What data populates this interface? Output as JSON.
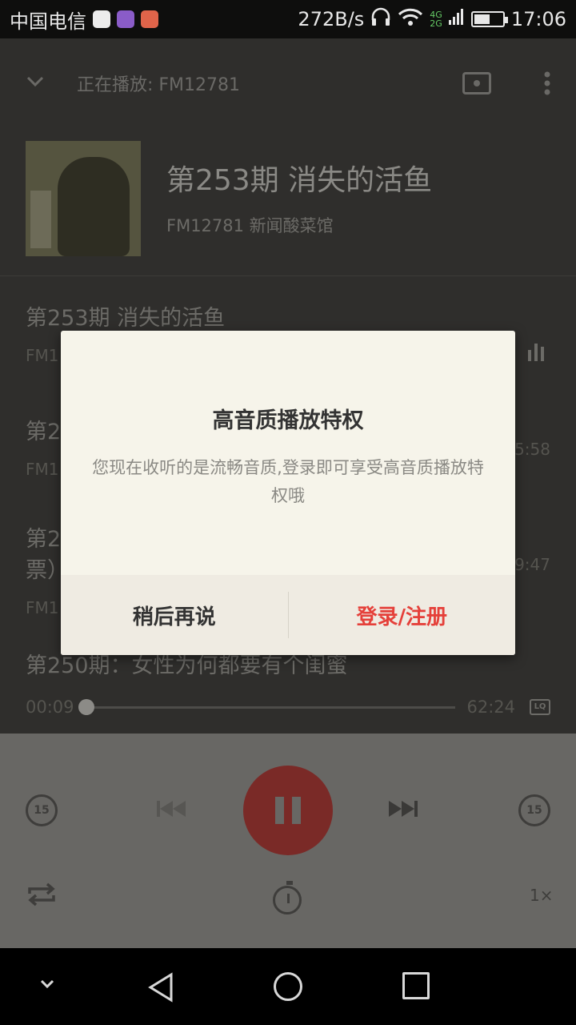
{
  "status_bar": {
    "carrier": "中国电信",
    "net_speed": "272B/s",
    "net_4g": "4G",
    "net_2g": "2G",
    "time": "17:06",
    "battery_level": 0.55
  },
  "header": {
    "now_playing_label": "正在播放: FM12781"
  },
  "now_playing": {
    "title": "第253期 消失的活鱼",
    "subtitle": "FM12781 新闻酸菜馆"
  },
  "episodes": [
    {
      "title": "第253期 消失的活鱼",
      "sub": "FM1",
      "duration": ""
    },
    {
      "title": "第2",
      "sub": "FM1",
      "duration": "5:58"
    },
    {
      "title": "第2",
      "title2": "票）",
      "sub": "FM1",
      "duration": "9:47"
    },
    {
      "title": "第250期：女性为何都要有个闺蜜",
      "sub": "",
      "duration": ""
    }
  ],
  "progress": {
    "current": "00:09",
    "total": "62:24",
    "fraction": 0.0024,
    "quality_badge": "LQ"
  },
  "controls": {
    "skip_back_label": "15",
    "skip_fwd_label": "15",
    "speed_label": "1×"
  },
  "dialog": {
    "title": "高音质播放特权",
    "message": "您现在收听的是流畅音质,登录即可享受高音质播放特权哦",
    "later_label": "稍后再说",
    "login_label": "登录/注册"
  },
  "colors": {
    "accent": "#e5403a",
    "dialog_bg": "#f6f4ea"
  }
}
